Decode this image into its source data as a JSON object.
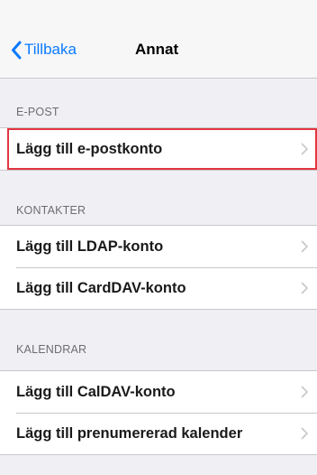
{
  "nav": {
    "back_label": "Tillbaka",
    "title": "Annat"
  },
  "sections": {
    "epost": {
      "header": "E-POST",
      "items": [
        "Lägg till e-postkonto"
      ]
    },
    "kontakter": {
      "header": "KONTAKTER",
      "items": [
        "Lägg till LDAP-konto",
        "Lägg till CardDAV-konto"
      ]
    },
    "kalendrar": {
      "header": "KALENDRAR",
      "items": [
        "Lägg till CalDAV-konto",
        "Lägg till prenumererad kalender"
      ]
    }
  },
  "icons": {
    "back": "chevron-left-icon",
    "disclosure": "chevron-right-icon"
  },
  "colors": {
    "accent": "#0a7aff",
    "background": "#efeff4",
    "header_text": "#6d6d72",
    "highlight": "#e2353f"
  }
}
